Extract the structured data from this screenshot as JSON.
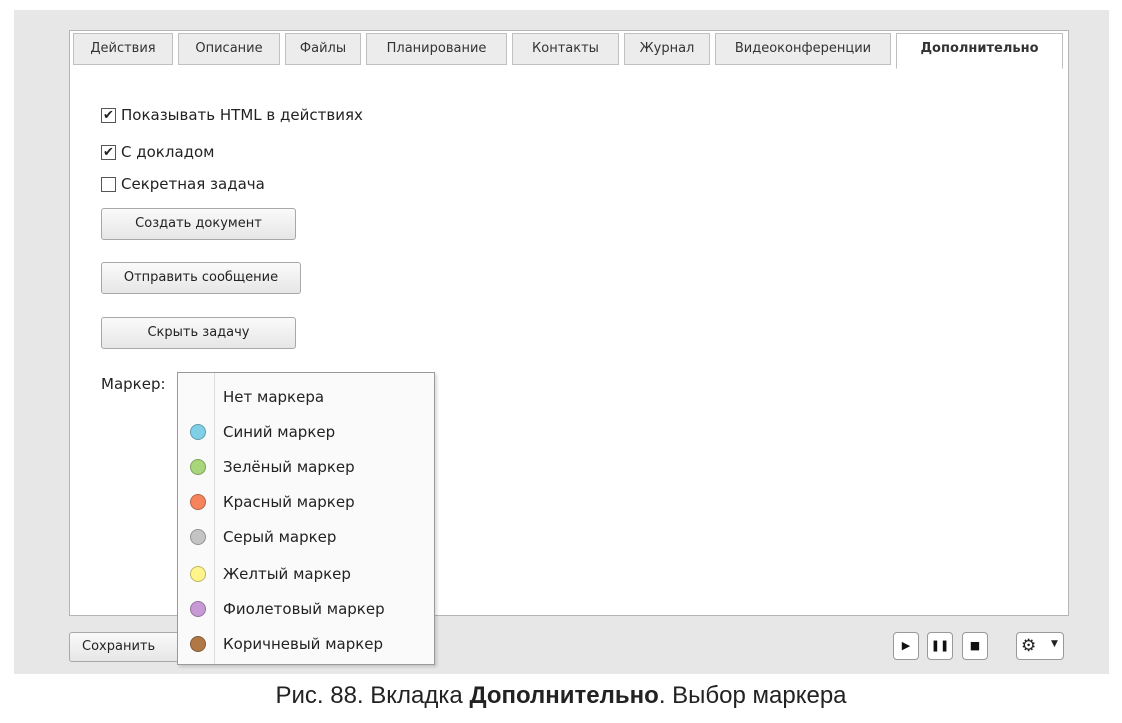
{
  "tabs": [
    "Действия",
    "Описание",
    "Файлы",
    "Планирование",
    "Контакты",
    "Журнал",
    "Видеоконференции",
    "Дополнительно"
  ],
  "checkboxes": {
    "html": {
      "label": "Показывать HTML в действиях",
      "checked": true
    },
    "report": {
      "label": "С докладом",
      "checked": true
    },
    "secret": {
      "label": "Секретная задача",
      "checked": false
    }
  },
  "buttons": {
    "create_doc": "Создать документ",
    "send_msg": "Отправить сообщение",
    "hide_task": "Скрыть задачу",
    "save": "Сохранить"
  },
  "marker_label": "Маркер:",
  "markers": [
    {
      "label": "Нет маркера",
      "color": ""
    },
    {
      "label": "Синий маркер",
      "color": "#7fd0e6"
    },
    {
      "label": "Зелёный маркер",
      "color": "#a8d67a"
    },
    {
      "label": "Красный маркер",
      "color": "#f5845c"
    },
    {
      "label": "Серый маркер",
      "color": "#c4c4c4"
    },
    {
      "label": "Желтый маркер",
      "color": "#fff58a"
    },
    {
      "label": "Фиолетовый маркер",
      "color": "#c79ad6"
    },
    {
      "label": "Коричневый маркер",
      "color": "#b07845"
    }
  ],
  "controls": {
    "play": "▶",
    "pause": "❚❚",
    "stop": "■",
    "gear": "⚙",
    "dropdown_arrow": "▼"
  },
  "caption": {
    "prefix": "Рис. 88. Вкладка ",
    "bold": "Дополнительно",
    "suffix": ". Выбор маркера"
  }
}
